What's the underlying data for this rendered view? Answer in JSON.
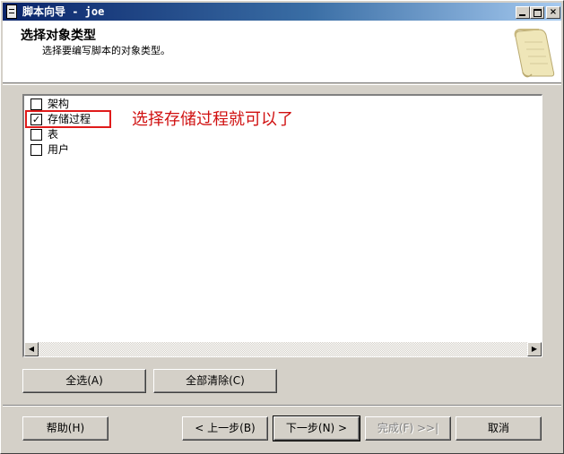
{
  "window": {
    "title": "脚本向导 - joe"
  },
  "header": {
    "title": "选择对象类型",
    "subtitle": "选择要编写脚本的对象类型。"
  },
  "object_types": [
    {
      "label": "架构",
      "checked": false
    },
    {
      "label": "存储过程",
      "checked": true
    },
    {
      "label": "表",
      "checked": false
    },
    {
      "label": "用户",
      "checked": false
    }
  ],
  "annotation": {
    "text": "选择存储过程就可以了",
    "color": "#d01010"
  },
  "buttons": {
    "select_all": "全选(A)",
    "clear_all": "全部清除(C)",
    "help": "帮助(H)",
    "back": "< 上一步(B)",
    "next": "下一步(N) >",
    "finish": "完成(F) >>|",
    "cancel": "取消"
  },
  "icons": {
    "window": "script-document-icon",
    "header_art": "scroll-parchment-icon"
  }
}
